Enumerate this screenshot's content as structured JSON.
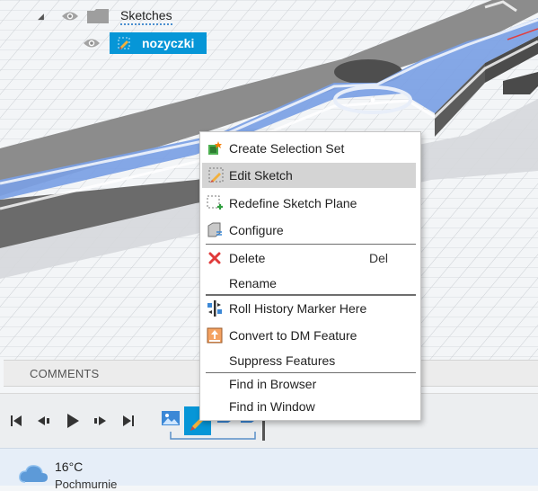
{
  "browser": {
    "folder_label": "Sketches",
    "sketch_label": "nozyczki"
  },
  "comments": {
    "label": "COMMENTS"
  },
  "context_menu": {
    "items": [
      {
        "label": "Create Selection Set",
        "icon": "selection-set-icon"
      },
      {
        "label": "Edit Sketch",
        "icon": "edit-sketch-icon",
        "highlighted": true
      },
      {
        "label": "Redefine Sketch Plane",
        "icon": "redefine-plane-icon"
      },
      {
        "label": "Configure",
        "icon": "configure-icon"
      },
      {
        "label": "Delete",
        "icon": "delete-icon",
        "shortcut": "Del"
      },
      {
        "label": "Rename"
      },
      {
        "label": "Roll History Marker Here",
        "icon": "roll-history-icon"
      },
      {
        "label": "Convert to DM Feature",
        "icon": "convert-dm-icon"
      },
      {
        "label": "Suppress Features"
      },
      {
        "label": "Find in Browser"
      },
      {
        "label": "Find in Window"
      }
    ]
  },
  "timeline": {
    "controls": [
      "skip-to-start-icon",
      "step-back-icon",
      "play-icon",
      "step-forward-icon",
      "skip-to-end-icon"
    ]
  },
  "taskbar": {
    "temperature": "16°C",
    "weather": "Pochmurnie"
  },
  "colors": {
    "accent": "#0696d7",
    "highlight": "#d4d4d4",
    "part_blue": "#7a9ce0",
    "part_grey": "#6e6e6e"
  }
}
